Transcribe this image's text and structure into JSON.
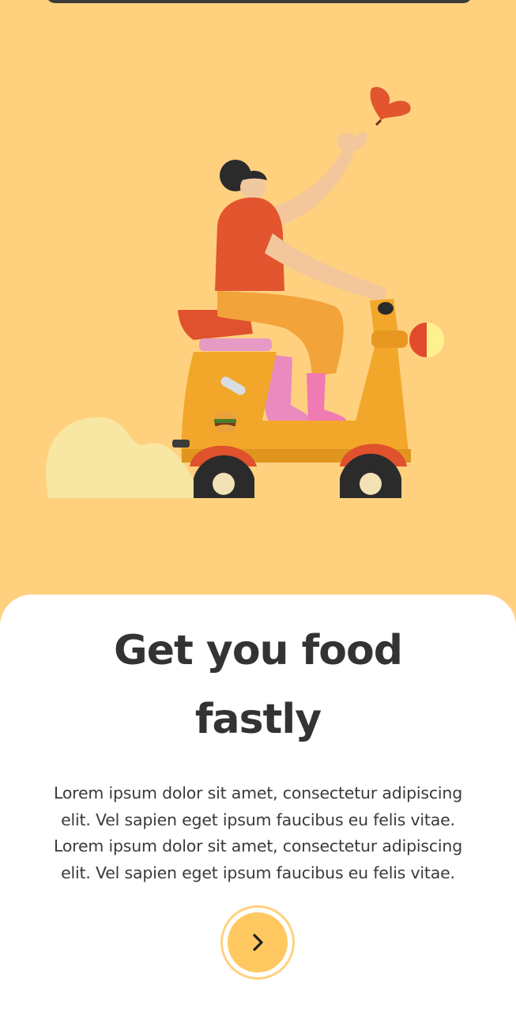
{
  "theme": {
    "background": "#ffd17f",
    "card": "#ffffff",
    "accent": "#ffc860",
    "text": "#333333"
  },
  "onboarding": {
    "title_line1": "Get you food",
    "title_line2": "fastly",
    "description_lines": [
      "Lorem ipsum dolor sit amet, consectetur adipiscing",
      "elit. Vel sapien eget ipsum faucibus eu felis vitae.",
      "Lorem ipsum dolor sit amet, consectetur adipiscing",
      "elit. Vel sapien eget ipsum faucibus eu felis vitae."
    ]
  },
  "next_button": {
    "icon": "chevron-right-icon"
  }
}
